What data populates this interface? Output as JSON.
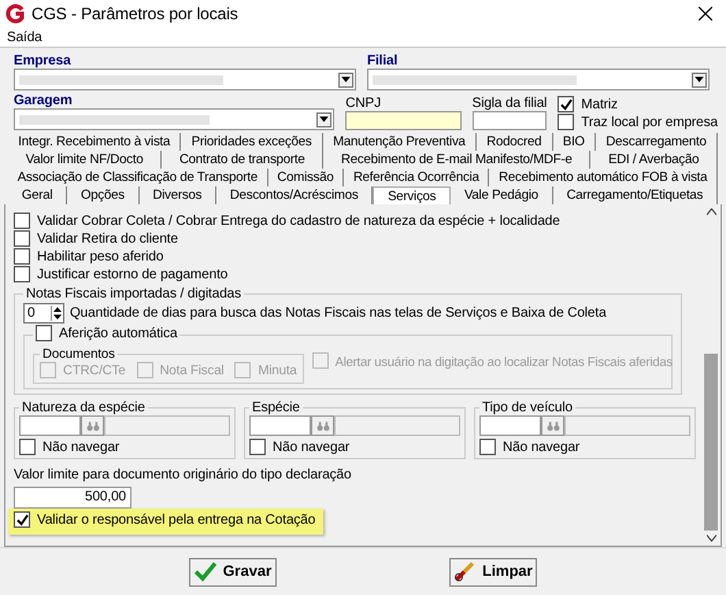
{
  "window": {
    "title": "CGS - Parâmetros por locais"
  },
  "menu": [
    "Saída"
  ],
  "header": {
    "empresa_label": "Empresa",
    "filial_label": "Filial",
    "garagem_label": "Garagem",
    "cnpj_label": "CNPJ",
    "sigla_label": "Sigla da filial",
    "checks": [
      {
        "label": "Matriz",
        "checked": true
      },
      {
        "label": "Traz local por empresa",
        "checked": false
      }
    ]
  },
  "tab_rows": [
    [
      {
        "label": "Integr. Recebimento à vista",
        "selected": false
      },
      {
        "label": "Prioridades exceções",
        "selected": false
      },
      {
        "label": "Manutenção Preventiva",
        "selected": false
      },
      {
        "label": "Rodocred",
        "selected": false
      },
      {
        "label": "BIO",
        "selected": false
      },
      {
        "label": "Descarregamento",
        "selected": false
      }
    ],
    [
      {
        "label": "Valor limite NF/Docto",
        "selected": false
      },
      {
        "label": "Contrato de transporte",
        "selected": false
      },
      {
        "label": "Recebimento de E-mail Manifesto/MDF-e",
        "selected": false
      },
      {
        "label": "EDI / Averbação",
        "selected": false
      }
    ],
    [
      {
        "label": "Associação de Classificação de Transporte",
        "selected": false
      },
      {
        "label": "Comissão",
        "selected": false
      },
      {
        "label": "Referência Ocorrência",
        "selected": false
      },
      {
        "label": "Recebimento automático FOB à vista",
        "selected": false
      }
    ],
    [
      {
        "label": "Geral",
        "selected": false
      },
      {
        "label": "Opções",
        "selected": false
      },
      {
        "label": "Diversos",
        "selected": false
      },
      {
        "label": "Descontos/Acréscimos",
        "selected": false
      },
      {
        "label": "Serviços",
        "selected": true
      },
      {
        "label": "Vale Pedágio",
        "selected": false
      },
      {
        "label": "Carregamento/Etiquetas",
        "selected": false
      }
    ]
  ],
  "options": [
    {
      "label": "Validar Cobrar Coleta / Cobrar Entrega do cadastro de natureza da espécie + localidade",
      "checked": false
    },
    {
      "label": "Validar Retira do cliente",
      "checked": false
    },
    {
      "label": "Habilitar peso aferido",
      "checked": false
    },
    {
      "label": "Justificar estorno de pagamento",
      "checked": false
    }
  ],
  "notas": {
    "title": "Notas Fiscais importadas / digitadas",
    "days_value": "0",
    "days_label": "Quantidade de dias para busca das Notas Fiscais nas telas de Serviços e Baixa de Coleta",
    "afericao": {
      "label": "Aferição automática",
      "checked": false
    },
    "documentos_title": "Documentos",
    "documentos": [
      {
        "label": "CTRC/CTe",
        "checked": false,
        "disabled": true
      },
      {
        "label": "Nota Fiscal",
        "checked": false,
        "disabled": true
      },
      {
        "label": "Minuta",
        "checked": false,
        "disabled": true
      }
    ],
    "alert": {
      "label": "Alertar usuário na digitação ao localizar Notas Fiscais aferidas",
      "checked": false,
      "disabled": true
    }
  },
  "lookups": [
    {
      "title": "Natureza da espécie",
      "check_label": "Não navegar",
      "checked": false
    },
    {
      "title": "Espécie",
      "check_label": "Não navegar",
      "checked": false
    },
    {
      "title": "Tipo de veículo",
      "check_label": "Não navegar",
      "checked": false
    }
  ],
  "limit": {
    "label": "Valor limite para documento originário do tipo declaração",
    "value": "500,00"
  },
  "highlight_option": {
    "label": "Validar o responsável pela entrega na Cotação",
    "checked": true
  },
  "buttons": [
    {
      "kind": "save",
      "label": "Gravar"
    },
    {
      "kind": "clear",
      "label": "Limpar"
    }
  ]
}
